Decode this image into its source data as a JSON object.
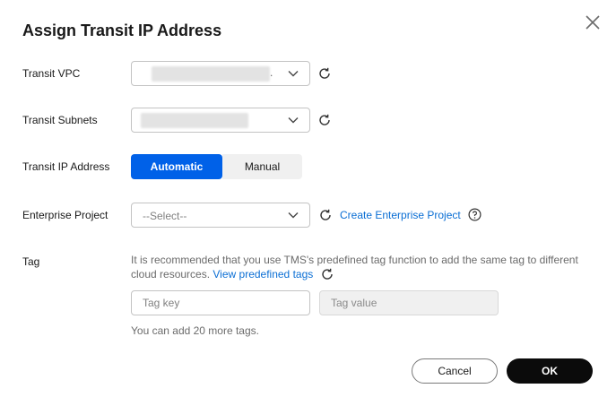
{
  "dialog": {
    "title": "Assign Transit IP Address"
  },
  "form": {
    "transit_vpc": {
      "label": "Transit VPC",
      "value_suffix": "."
    },
    "transit_subnets": {
      "label": "Transit Subnets"
    },
    "transit_ip": {
      "label": "Transit IP Address",
      "options": [
        "Automatic",
        "Manual"
      ],
      "selected": "Automatic"
    },
    "enterprise_project": {
      "label": "Enterprise Project",
      "placeholder": "--Select--",
      "create_link": "Create Enterprise Project"
    },
    "tag": {
      "label": "Tag",
      "note": "It is recommended that you use TMS's predefined tag function to add the same tag to different cloud resources.",
      "view_link": "View predefined tags",
      "key_placeholder": "Tag key",
      "value_placeholder": "Tag value",
      "hint": "You can add 20 more tags."
    }
  },
  "footer": {
    "cancel_label": "Cancel",
    "ok_label": "OK"
  },
  "colors": {
    "primary": "#0061e8",
    "link": "#0a6ed4",
    "ok_button": "#0b0b0b"
  },
  "icons": [
    "close-icon",
    "chevron-down-icon",
    "refresh-icon",
    "help-icon"
  ]
}
